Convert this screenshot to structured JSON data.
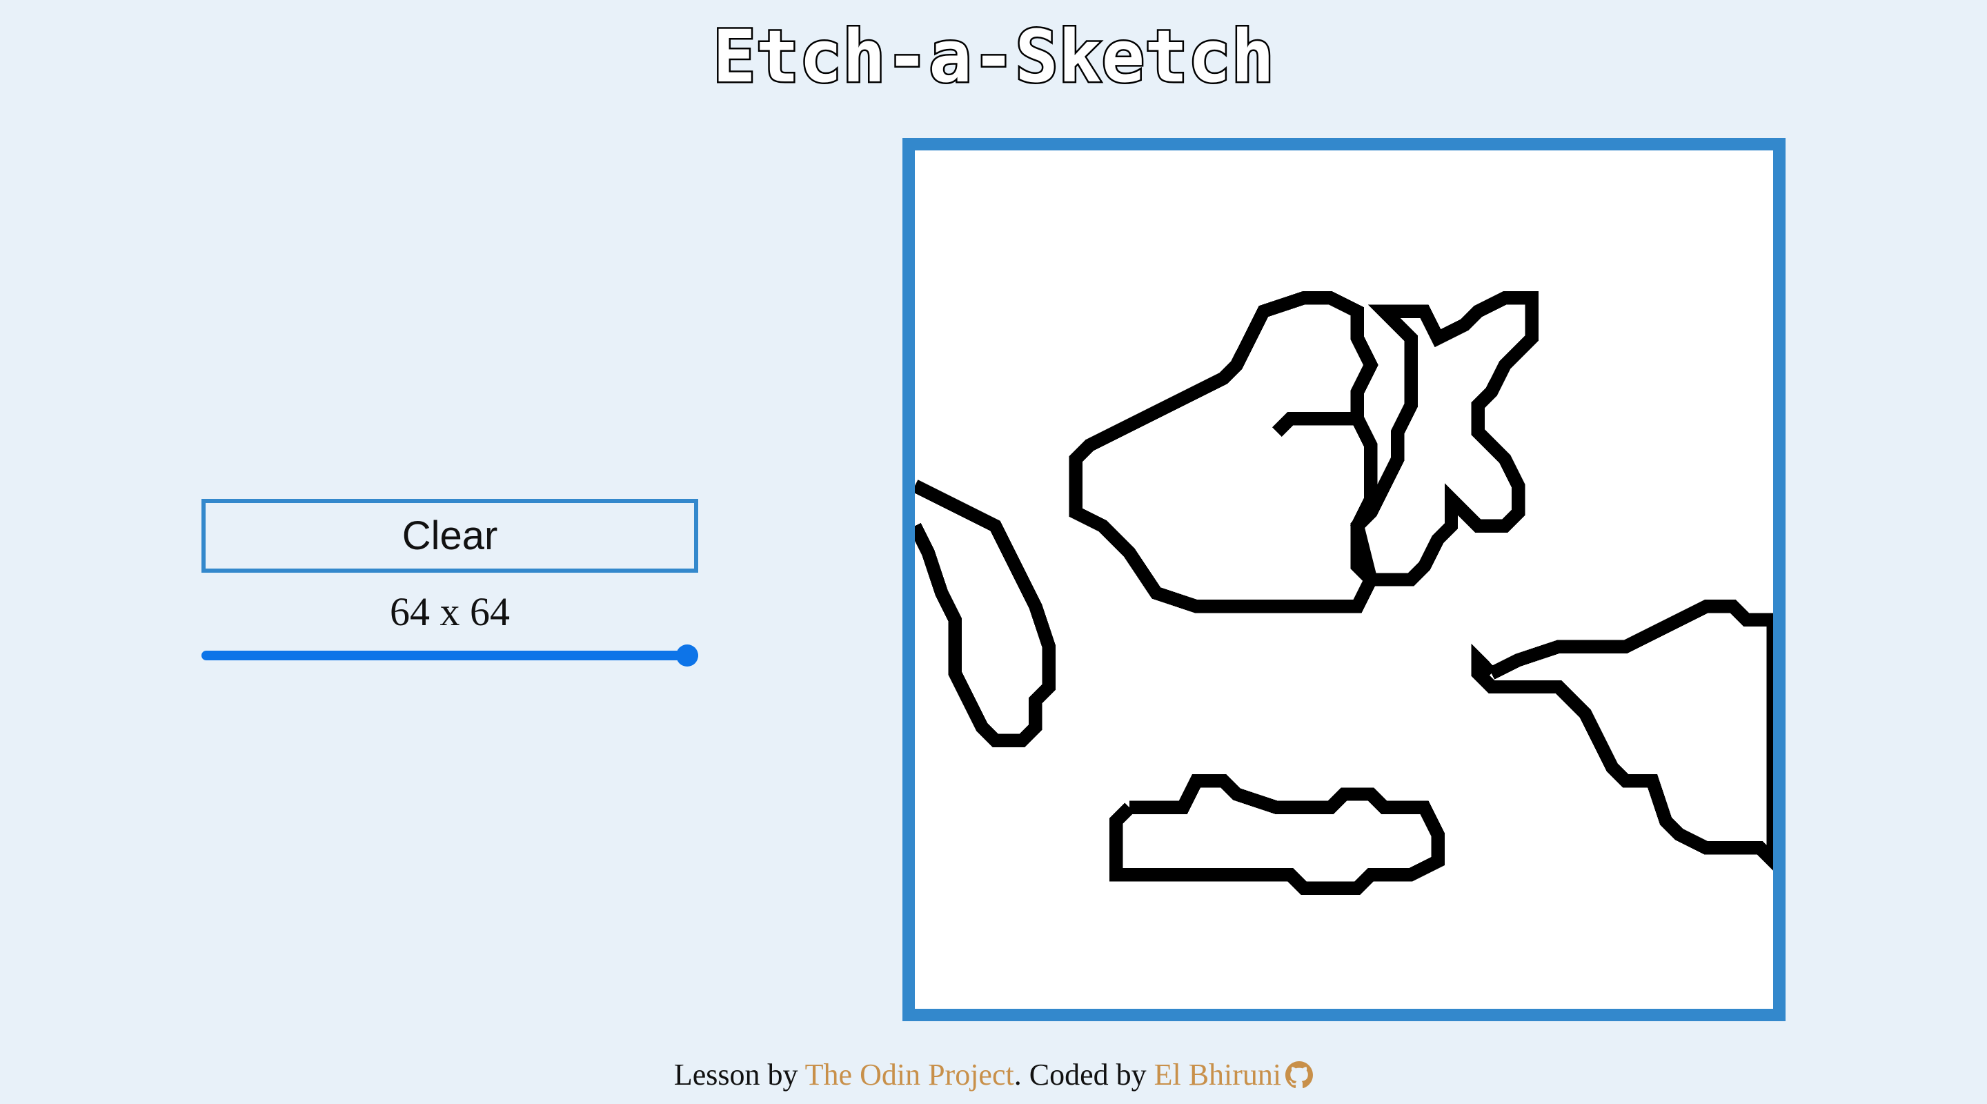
{
  "page": {
    "title": "Etch-a-Sketch"
  },
  "controls": {
    "clear_label": "Clear",
    "size_label": "64 x 64",
    "slider_value": 64,
    "slider_max": 64
  },
  "board": {
    "grid_size": 64,
    "ink_color": "#000000",
    "background_color": "#ffffff",
    "border_color": "#3388cc"
  },
  "footer": {
    "lesson_prefix": "Lesson by ",
    "lesson_link": "The Odin Project",
    "coded_prefix": ". Coded by ",
    "author_link": "El Bhiruni",
    "icon": "github-icon",
    "link_color": "#c8904a"
  }
}
